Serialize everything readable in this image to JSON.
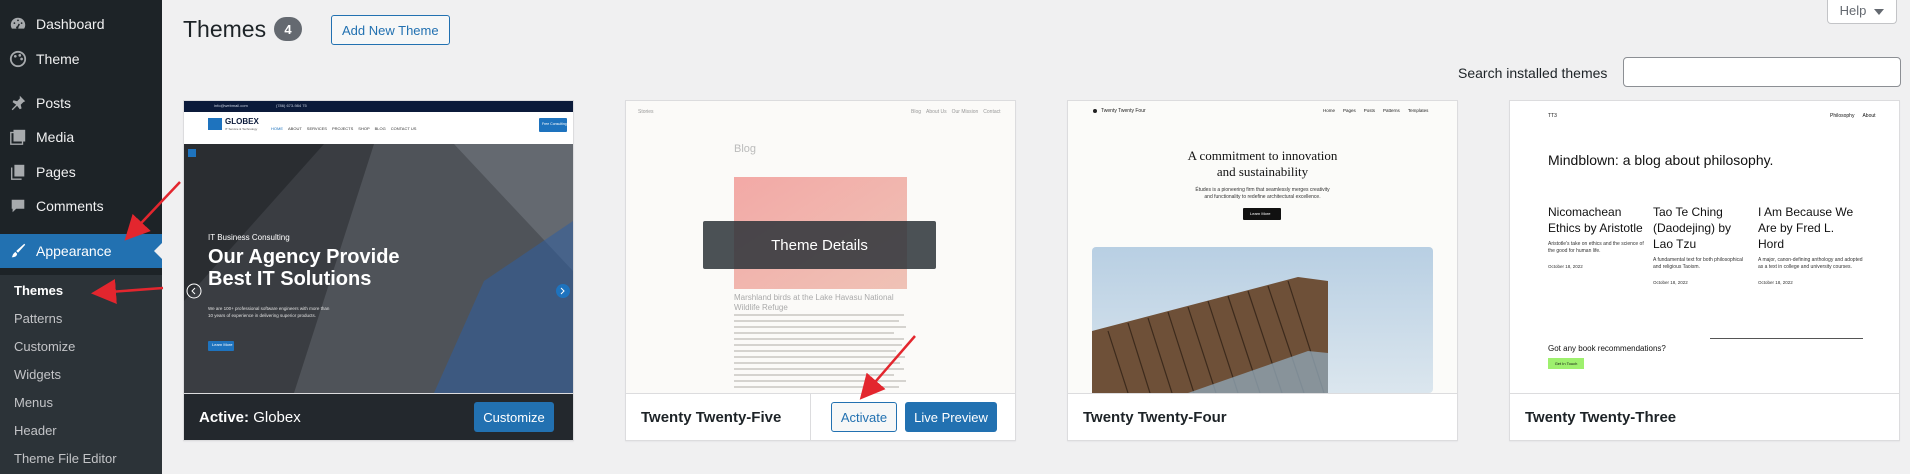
{
  "sidebar": {
    "items": [
      {
        "label": "Dashboard",
        "icon": "dashboard-icon"
      },
      {
        "label": "Theme",
        "icon": "palette-icon"
      },
      {
        "label": "Posts",
        "icon": "pin-icon"
      },
      {
        "label": "Media",
        "icon": "media-icon"
      },
      {
        "label": "Pages",
        "icon": "pages-icon"
      },
      {
        "label": "Comments",
        "icon": "comments-icon"
      },
      {
        "label": "Appearance",
        "icon": "brush-icon"
      }
    ],
    "submenu": [
      "Themes",
      "Patterns",
      "Customize",
      "Widgets",
      "Menus",
      "Header",
      "Theme File Editor"
    ]
  },
  "header": {
    "title": "Themes",
    "count": "4",
    "add_new": "Add New Theme",
    "help": "Help",
    "search_label": "Search installed themes",
    "search_value": ""
  },
  "themes": [
    {
      "name_prefix": "Active:",
      "name": "Globex",
      "button": "Customize",
      "preview": {
        "topbar_email": "info@webmail.com",
        "topbar_phone": "(786) 673-984 75",
        "logo": "GLOBEX",
        "logo_sub": "IT Service & Technology",
        "nav": [
          "HOME",
          "ABOUT",
          "SERVICES",
          "PROJECTS",
          "SHOP",
          "BLOG",
          "CONTACT US"
        ],
        "cta": "Free Consulting",
        "kicker": "IT Business Consulting",
        "headline1": "Our Agency Provide",
        "headline2": "Best IT Solutions",
        "body1": "We are 100+ professional software engineers with more than",
        "body2": "10 years of experience in delivering superior products.",
        "button": "Learn More"
      }
    },
    {
      "name": "Twenty Twenty-Five",
      "overlay": "Theme Details",
      "activate": "Activate",
      "live_preview": "Live Preview",
      "preview": {
        "site": "Stories",
        "nav": [
          "Blog",
          "About Us",
          "Our Mission",
          "Contact"
        ],
        "heading": "Blog",
        "caption1": "Marshland birds at the Lake Havasu National",
        "caption2": "Wildlife Refuge"
      }
    },
    {
      "name": "Twenty Twenty-Four",
      "preview": {
        "site": "Twenty Twenty Four",
        "nav": [
          "Home",
          "Pages",
          "Posts",
          "Patterns",
          "Templates"
        ],
        "headline1": "A commitment to innovation",
        "headline2": "and sustainability",
        "body1": "Études is a pioneering firm that seamlessly merges creativity",
        "body2": "and functionality to redefine architectural excellence.",
        "button": "Learn More"
      }
    },
    {
      "name": "Twenty Twenty-Three",
      "preview": {
        "site": "TT3",
        "nav": [
          "Philosophy",
          "About"
        ],
        "headline": "Mindblown: a blog about philosophy.",
        "posts": [
          {
            "title": "Nicomachean Ethics by Aristotle",
            "excerpt": "Aristotle's take on ethics and the science of the good for human life.",
            "date": "October 18, 2022"
          },
          {
            "title": "Tao Te Ching (Daodejing) by Lao Tzu",
            "excerpt": "A fundamental text for both philosophical and religious Taoism.",
            "date": "October 18, 2022"
          },
          {
            "title": "I Am Because We Are by Fred L. Hord",
            "excerpt": "A major, canon-defining anthology and adopted as a text in college and university courses.",
            "date": "October 18, 2022"
          }
        ],
        "cta_text": "Got any book recommendations?",
        "cta_button": "Get In Touch"
      }
    }
  ],
  "colors": {
    "sidebar_bg": "#1d2327",
    "accent": "#2271b1",
    "annotation_arrow": "#e3262e"
  }
}
